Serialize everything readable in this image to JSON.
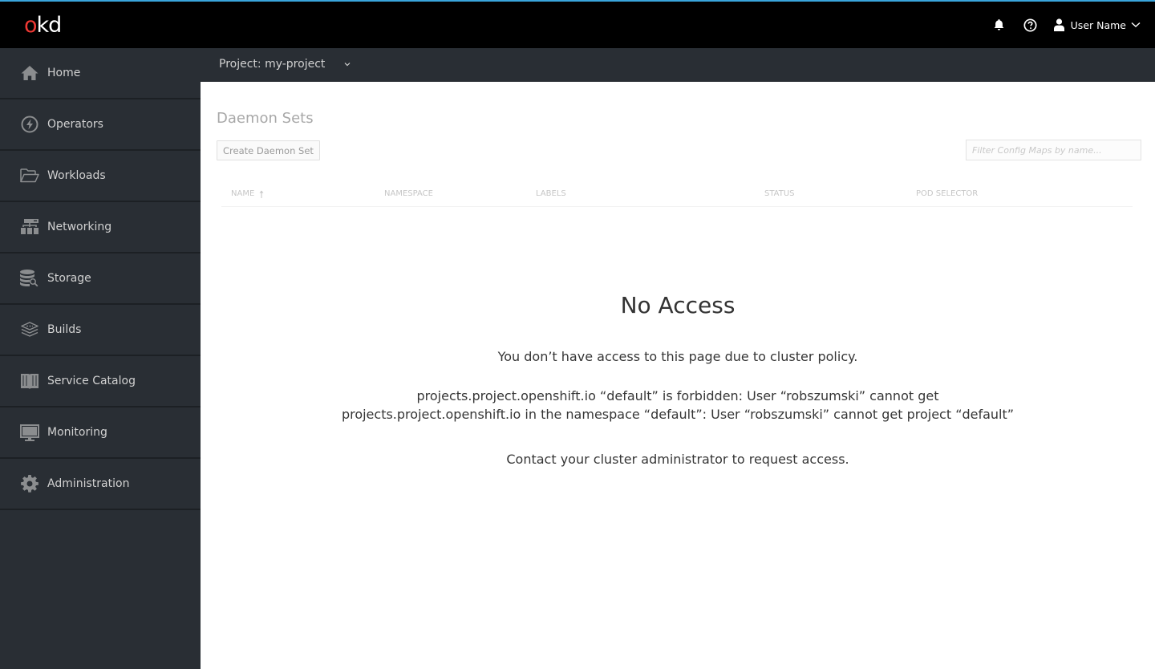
{
  "masthead": {
    "logo_o": "o",
    "logo_rest": "kd",
    "user_name": "User Name",
    "icons": [
      "bell-icon",
      "help-icon",
      "user-icon"
    ]
  },
  "sidebar": {
    "items": [
      {
        "label": "Home",
        "icon": "home-icon"
      },
      {
        "label": "Operators",
        "icon": "bolt-icon"
      },
      {
        "label": "Workloads",
        "icon": "folder-open-icon"
      },
      {
        "label": "Networking",
        "icon": "network-icon"
      },
      {
        "label": "Storage",
        "icon": "database-icon"
      },
      {
        "label": "Builds",
        "icon": "layers-icon"
      },
      {
        "label": "Service Catalog",
        "icon": "book-icon"
      },
      {
        "label": "Monitoring",
        "icon": "monitor-icon"
      },
      {
        "label": "Administration",
        "icon": "gear-icon"
      }
    ]
  },
  "project": {
    "label": "Project: my-project"
  },
  "main": {
    "title": "Daemon Sets",
    "create_button": "Create Daemon Set",
    "filter_placeholder": "Filter Config Maps by name...",
    "columns": [
      "NAME",
      "NAMESPACE",
      "LABELS",
      "STATUS",
      "POD SELECTOR"
    ],
    "sorted_column": "NAME",
    "sort_direction": "ascending"
  },
  "no_access": {
    "title": "No Access",
    "message": "You don’t have access to this page due to cluster policy.",
    "error": "projects.project.openshift.io “default” is forbidden: User “robszumski” cannot get projects.project.openshift.io in the namespace “default”: User “robszumski” cannot get project “default”",
    "contact": "Contact your cluster administrator to request access."
  },
  "colors": {
    "accent_line": "#39a5dc",
    "logo_red": "#ee3833",
    "sidebar_bg": "#292e34",
    "masthead_bg": "#000000"
  }
}
